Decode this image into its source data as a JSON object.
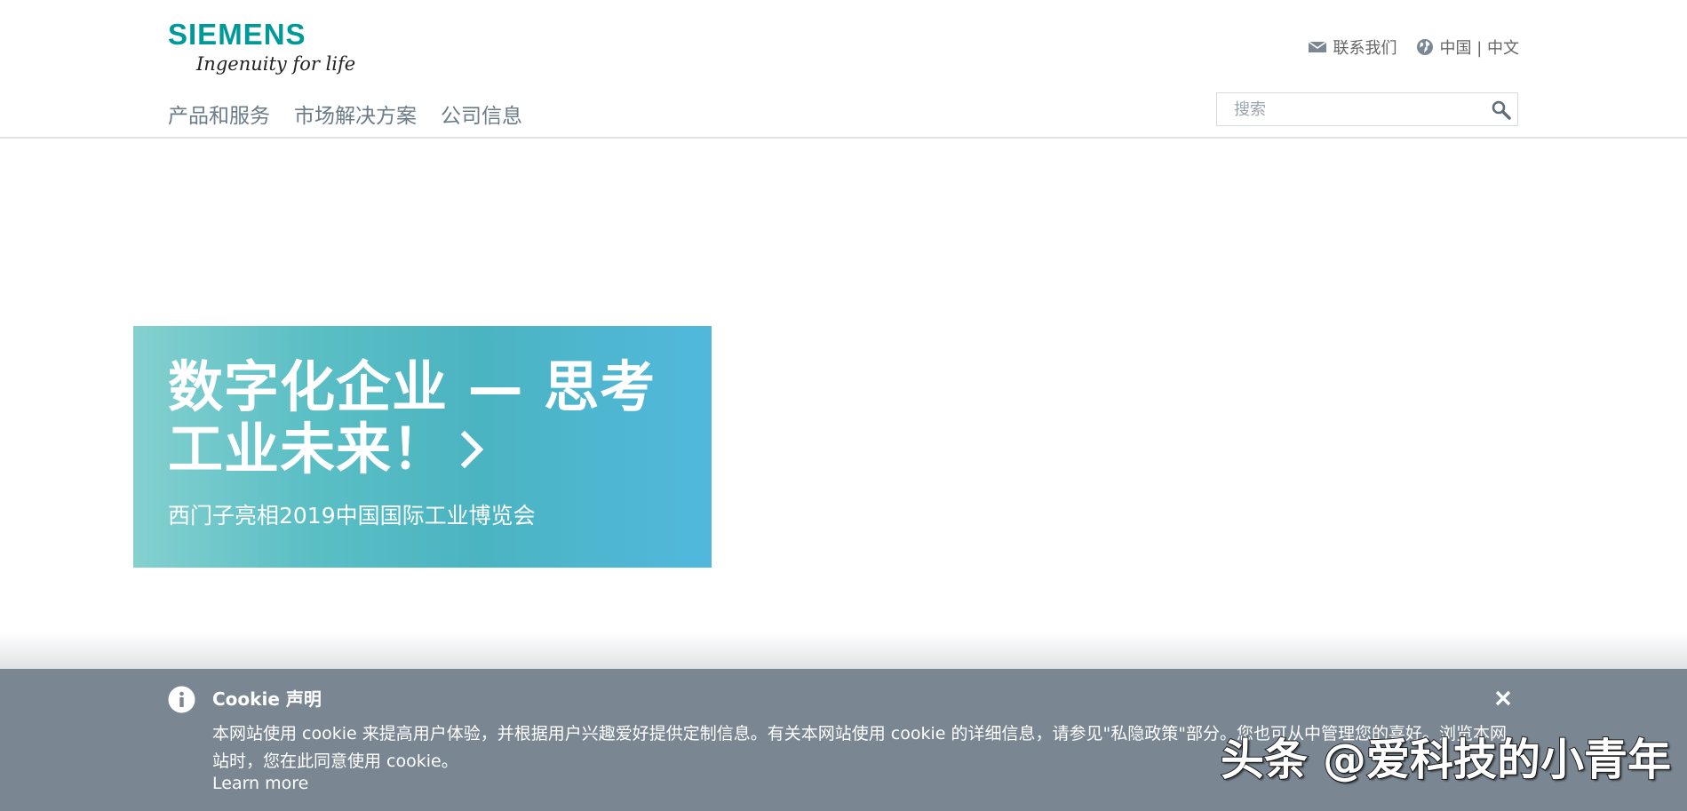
{
  "header": {
    "logo": {
      "brand": "SIEMENS",
      "tagline": "Ingenuity for life",
      "brand_color": "#009999"
    },
    "utility": {
      "contact_label": "联系我们",
      "contact_icon": "mail-icon",
      "region_label": "中国 | 中文",
      "region_icon": "globe-icon"
    },
    "nav": [
      {
        "label": "产品和服务"
      },
      {
        "label": "市场解决方案"
      },
      {
        "label": "公司信息"
      }
    ],
    "search": {
      "placeholder": "搜索",
      "value": "",
      "icon": "search-icon"
    }
  },
  "hero": {
    "title": "数字化企业 — 思考工业未来！",
    "subtitle": "西门子亮相2019中国国际工业博览会",
    "icon": "chevron-right-icon",
    "gradient_colors": [
      "#84d0cf",
      "#4bb4c1",
      "#51b8dd"
    ]
  },
  "cookie": {
    "title": "Cookie 声明",
    "text": "本网站使用 cookie 来提高用户体验，并根据用户兴趣爱好提供定制信息。有关本网站使用 cookie 的详细信息，请参见\"私隐政策\"部分。您也可从中管理您的喜好。浏览本网站时，您在此同意使用 cookie。",
    "link_label": "Learn more",
    "info_icon": "info-icon",
    "close_icon": "close-icon",
    "background": "#7a8792"
  },
  "watermark": {
    "text": "头条 @爱科技的小青年"
  }
}
